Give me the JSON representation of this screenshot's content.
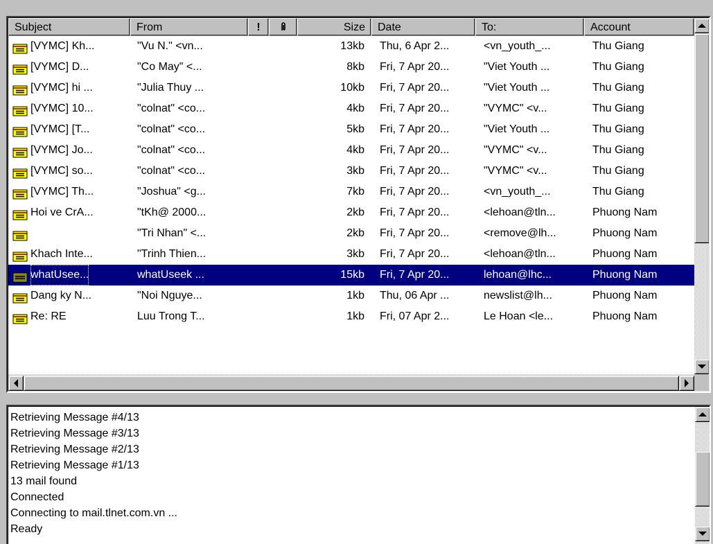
{
  "columns": {
    "subject": "Subject",
    "from": "From",
    "flag": "!",
    "attach": "0",
    "size": "Size",
    "date": "Date",
    "to": "To:",
    "account": "Account"
  },
  "messages": [
    {
      "subject": "[VYMC] Kh...",
      "from": "\"Vu N.\" <vn...",
      "size": "13kb",
      "date": "Thu, 6 Apr 2...",
      "to": "<vn_youth_...",
      "account": "Thu Giang",
      "icon": "envelope-new-icon"
    },
    {
      "subject": "[VYMC] D...",
      "from": "\"Co May\" <...",
      "size": "8kb",
      "date": "Fri, 7 Apr 20...",
      "to": "\"Viet Youth ...",
      "account": "Thu Giang",
      "icon": "envelope-new-icon"
    },
    {
      "subject": "[VYMC] hi ...",
      "from": "\"Julia Thuy ...",
      "size": "10kb",
      "date": "Fri, 7 Apr 20...",
      "to": "\"Viet Youth ...",
      "account": "Thu Giang",
      "icon": "envelope-new-icon"
    },
    {
      "subject": "[VYMC] 10...",
      "from": "\"colnat\" <co...",
      "size": "4kb",
      "date": "Fri, 7 Apr 20...",
      "to": "\"VYMC\" <v...",
      "account": "Thu Giang",
      "icon": "envelope-new-icon"
    },
    {
      "subject": "[VYMC] [T...",
      "from": "\"colnat\" <co...",
      "size": "5kb",
      "date": "Fri, 7 Apr 20...",
      "to": "\"Viet Youth ...",
      "account": "Thu Giang",
      "icon": "envelope-new-icon"
    },
    {
      "subject": "[VYMC] Jo...",
      "from": "\"colnat\" <co...",
      "size": "4kb",
      "date": "Fri, 7 Apr 20...",
      "to": "\"VYMC\" <v...",
      "account": "Thu Giang",
      "icon": "envelope-new-icon"
    },
    {
      "subject": "[VYMC] so...",
      "from": "\"colnat\" <co...",
      "size": "3kb",
      "date": "Fri, 7 Apr 20...",
      "to": "\"VYMC\" <v...",
      "account": "Thu Giang",
      "icon": "envelope-new-icon"
    },
    {
      "subject": "[VYMC] Th...",
      "from": "\"Joshua\" <g...",
      "size": "7kb",
      "date": "Fri, 7 Apr 20...",
      "to": "<vn_youth_...",
      "account": "Thu Giang",
      "icon": "envelope-new-icon"
    },
    {
      "subject": "Hoi ve CrA...",
      "from": "\"tKh@ 2000...",
      "size": "2kb",
      "date": "Fri, 7 Apr 20...",
      "to": "<lehoan@tln...",
      "account": "Phuong Nam",
      "icon": "envelope-new-icon"
    },
    {
      "subject": "",
      "from": "\"Tri Nhan\" <...",
      "size": "2kb",
      "date": "Fri, 7 Apr 20...",
      "to": "<remove@lh...",
      "account": "Phuong Nam",
      "icon": "envelope-new-icon"
    },
    {
      "subject": "Khach Inte...",
      "from": "\"Trinh Thien...",
      "size": "3kb",
      "date": "Fri, 7 Apr 20...",
      "to": "<lehoan@tln...",
      "account": "Phuong Nam",
      "icon": "envelope-new-icon"
    },
    {
      "subject": "whatUsee...",
      "from": "whatUseek ...",
      "size": "15kb",
      "date": "Fri, 7 Apr 20...",
      "to": "lehoan@lhc...",
      "account": "Phuong Nam",
      "icon": "envelope-selected-icon",
      "selected": true
    },
    {
      "subject": "Dang ky N...",
      "from": "\"Noi Nguye...",
      "size": "1kb",
      "date": "Thu, 06 Apr ...",
      "to": "newslist@lh...",
      "account": "Phuong Nam",
      "icon": "envelope-new-icon"
    },
    {
      "subject": "Re: RE",
      "from": "Luu Trong T...",
      "size": "1kb",
      "date": "Fri, 07 Apr 2...",
      "to": "Le Hoan <le...",
      "account": "Phuong Nam",
      "icon": "envelope-new-icon"
    }
  ],
  "log": [
    "Retrieving Message #4/13",
    "Retrieving Message #3/13",
    "Retrieving Message #2/13",
    "Retrieving Message #1/13",
    "13 mail found",
    "Connected",
    "Connecting to mail.tlnet.com.vn ...",
    "Ready"
  ],
  "colors": {
    "selection": "#000080",
    "envelope": "#ffff00",
    "envelope_stripe": "#800000",
    "face": "#c0c0c0"
  }
}
